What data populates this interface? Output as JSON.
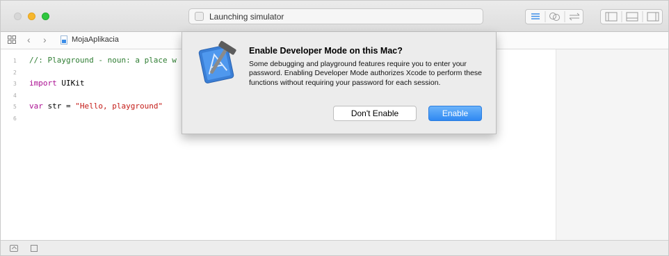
{
  "toolbar": {
    "activity_status": "Launching simulator",
    "buttons": [
      "editor-standard",
      "editor-assistant",
      "editor-version",
      "toggle-navigator",
      "toggle-debug-area",
      "toggle-utilities"
    ],
    "accent_color": "#3b8de8"
  },
  "breadcrumb": {
    "back": "‹",
    "forward": "›",
    "file": "MojaAplikacia"
  },
  "editor": {
    "line_numbers": [
      "1",
      "2",
      "3",
      "4",
      "5",
      "6"
    ],
    "lines": [
      {
        "segments": [
          {
            "text": "//: Playground - noun: a place w",
            "style": "cmt"
          }
        ]
      },
      {
        "segments": []
      },
      {
        "segments": [
          {
            "text": "import",
            "style": "kw"
          },
          {
            "text": " UIKit",
            "style": ""
          }
        ]
      },
      {
        "segments": []
      },
      {
        "segments": [
          {
            "text": "var",
            "style": "kw"
          },
          {
            "text": " str = ",
            "style": ""
          },
          {
            "text": "\"Hello, playground\"",
            "style": "str"
          }
        ]
      },
      {
        "segments": []
      }
    ]
  },
  "dialog": {
    "title": "Enable Developer Mode on this Mac?",
    "message": "Some debugging and playground features require you to enter your password. Enabling Developer Mode authorizes Xcode to perform these functions without requiring your password for each session.",
    "cancel_label": "Don't Enable",
    "confirm_label": "Enable",
    "icon": "xcode-hammer-icon"
  }
}
